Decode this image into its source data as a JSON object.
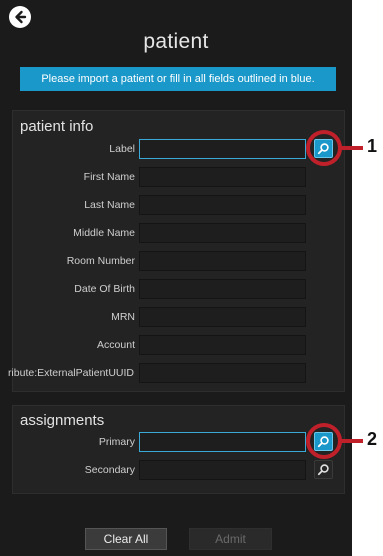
{
  "header": {
    "title": "patient"
  },
  "banner": {
    "message": "Please import a patient or fill in all fields outlined in blue."
  },
  "patient_info": {
    "title": "patient info",
    "fields": [
      {
        "label": "Label",
        "value": "",
        "highlighted": true
      },
      {
        "label": "First Name",
        "value": ""
      },
      {
        "label": "Last Name",
        "value": ""
      },
      {
        "label": "Middle Name",
        "value": ""
      },
      {
        "label": "Room Number",
        "value": ""
      },
      {
        "label": "Date Of Birth",
        "value": ""
      },
      {
        "label": "MRN",
        "value": ""
      },
      {
        "label": "Account",
        "value": ""
      },
      {
        "label": "ribute:ExternalPatientUUID",
        "value": ""
      }
    ]
  },
  "assignments": {
    "title": "assignments",
    "fields": [
      {
        "label": "Primary",
        "value": "",
        "highlighted": true
      },
      {
        "label": "Secondary",
        "value": ""
      }
    ]
  },
  "callouts": [
    "1",
    "2"
  ],
  "footer": {
    "clear_label": "Clear All",
    "admit_label": "Admit"
  },
  "icons": {
    "back": "back-arrow-icon",
    "lookup": "magnifier-icon"
  },
  "colors": {
    "accent": "#1a98c9",
    "callout": "#c0202a",
    "background": "#1b1b1b"
  }
}
